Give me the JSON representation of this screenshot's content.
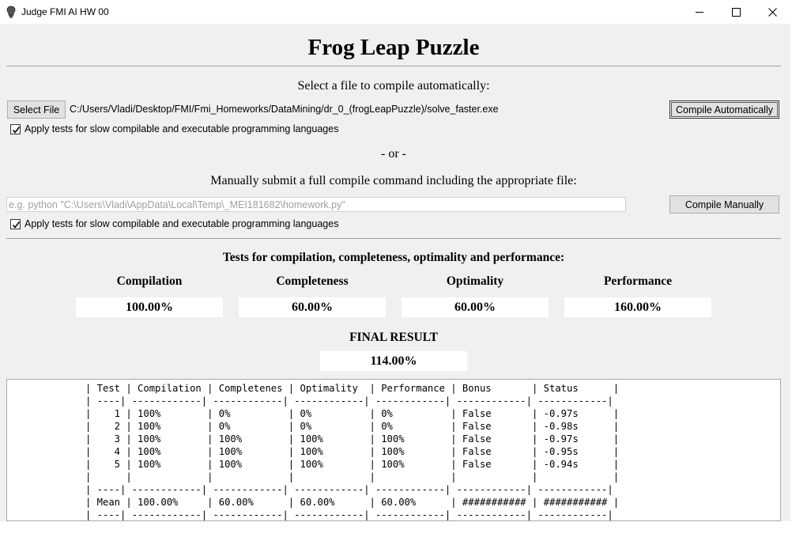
{
  "window": {
    "title": "Judge FMI AI HW 00"
  },
  "heading": "Frog Leap Puzzle",
  "auto_section": {
    "prompt": "Select a file to compile automatically:",
    "select_button": "Select File",
    "file_path": "C:/Users/Vladi/Desktop/FMI/Fmi_Homeworks/DataMining/dr_0_(frogLeapPuzzle)/solve_faster.exe",
    "compile_button": "Compile Automatically",
    "slow_tests_checkbox": {
      "label": "Apply tests for slow compilable and executable programming languages",
      "checked": true
    }
  },
  "or_label": "- or -",
  "manual_section": {
    "prompt": "Manually submit a full compile command including the appropriate file:",
    "command_placeholder": "e.g.    python \"C:\\Users\\Vladi\\AppData\\Local\\Temp\\_MEI181682\\homework.py\"",
    "compile_button": "Compile Manually",
    "slow_tests_checkbox": {
      "label": "Apply tests for slow compilable and executable programming languages",
      "checked": true
    }
  },
  "tests_heading": "Tests for compilation, completeness, optimality and performance:",
  "metrics": [
    {
      "label": "Compilation",
      "value": "100.00%"
    },
    {
      "label": "Completeness",
      "value": "60.00%"
    },
    {
      "label": "Optimality",
      "value": "60.00%"
    },
    {
      "label": "Performance",
      "value": "160.00%"
    }
  ],
  "final_result": {
    "label": "FINAL RESULT",
    "value": "114.00%"
  },
  "results_table": {
    "columns": [
      "Test",
      "Compilation",
      "Completeness",
      "Optimality",
      "Performance",
      "Bonus",
      "Status"
    ],
    "rows": [
      [
        "1",
        "100%",
        "0%",
        "0%",
        "0%",
        "False",
        "-0.97s"
      ],
      [
        "2",
        "100%",
        "0%",
        "0%",
        "0%",
        "False",
        "-0.98s"
      ],
      [
        "3",
        "100%",
        "100%",
        "100%",
        "100%",
        "False",
        "-0.97s"
      ],
      [
        "4",
        "100%",
        "100%",
        "100%",
        "100%",
        "False",
        "-0.95s"
      ],
      [
        "5",
        "100%",
        "100%",
        "100%",
        "100%",
        "False",
        "-0.94s"
      ]
    ],
    "mean_row": [
      "Mean",
      "100.00%",
      "60.00%",
      "60.00%",
      "60.00%",
      "###########",
      "###########"
    ]
  },
  "icons": {
    "app": "light-bulb-icon",
    "minimize": "minimize-icon",
    "maximize": "maximize-icon",
    "close": "close-icon",
    "check": "checkmark-icon"
  },
  "colors": {
    "background": "#f0f0f0",
    "button": "#e1e1e1",
    "button_border": "#adadad",
    "separator": "#a0a0a0",
    "placeholder": "#a0a0a0"
  }
}
